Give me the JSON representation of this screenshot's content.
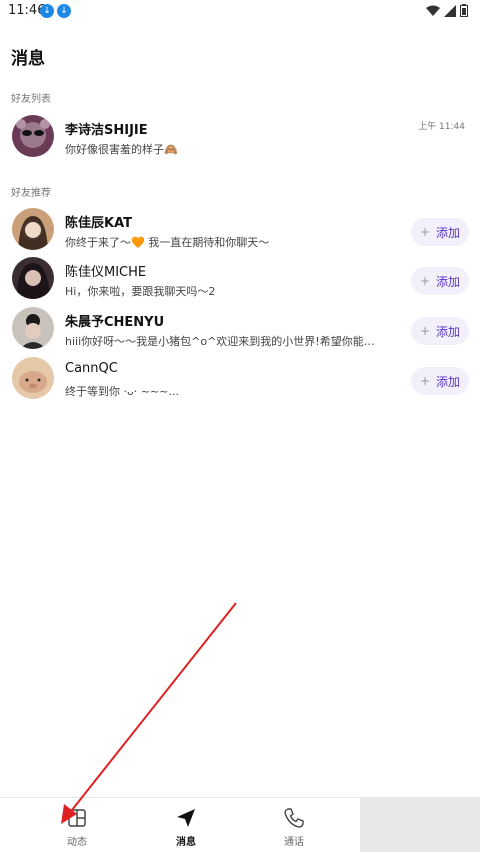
{
  "status": {
    "time": "11:46"
  },
  "page": {
    "title": "消息"
  },
  "sections": {
    "friends": "好友列表",
    "recommend": "好友推荐"
  },
  "friends": [
    {
      "name": "李诗洁SHIJIE",
      "message": "你好像很害羞的样子🙈",
      "time": "上午 11:44"
    }
  ],
  "recommendations": [
    {
      "name": "陈佳辰KAT",
      "message": "你终于来了～🧡 我一直在期待和你聊天～",
      "add": "添加"
    },
    {
      "name": "陈佳仪MICHE",
      "message": "Hi，你来啦，要跟我聊天吗～2",
      "add": "添加"
    },
    {
      "name": "朱晨予CHENYU",
      "message": "hiii你好呀～～我是小猪包^o^欢迎来到我的小世界!希望你能天...",
      "add": "添加"
    },
    {
      "name": "CannQC",
      "message": "终于等到你 ·ᴗ· ~~~...",
      "add": "添加"
    }
  ],
  "nav": {
    "feed": "动态",
    "messages": "消息",
    "calls": "通话"
  },
  "colors": {
    "accent": "#5b35c7",
    "arrow": "#e02020"
  }
}
